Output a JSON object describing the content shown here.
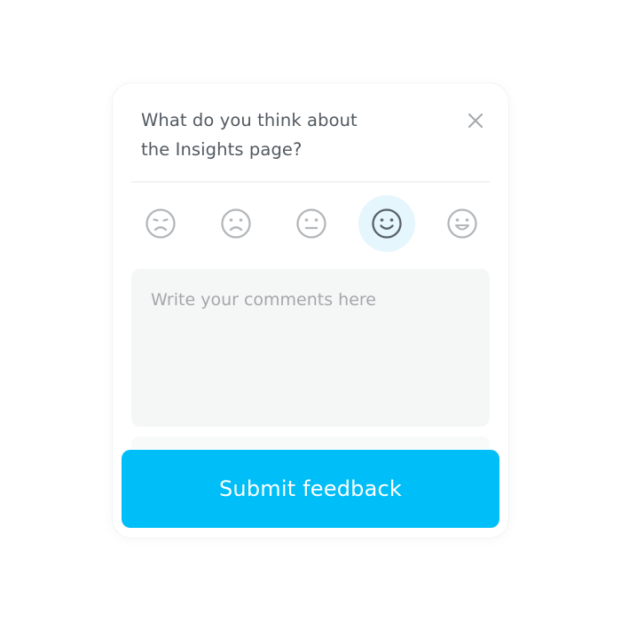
{
  "dialog": {
    "title_line1": "What do you think about",
    "title_line2": "the Insights page?",
    "close_icon": "close-icon"
  },
  "rating": {
    "options": [
      {
        "icon": "crying-face-icon",
        "label": "Very unhappy"
      },
      {
        "icon": "sad-face-icon",
        "label": "Unhappy"
      },
      {
        "icon": "neutral-face-icon",
        "label": "Neutral"
      },
      {
        "icon": "happy-face-icon",
        "label": "Happy"
      },
      {
        "icon": "very-happy-face-icon",
        "label": "Very happy"
      }
    ],
    "selected_index": 3,
    "selected_background": "#e5f6fd"
  },
  "comments": {
    "placeholder": "Write your comments here",
    "value": ""
  },
  "submit": {
    "label": "Submit feedback",
    "color": "#00bef7"
  }
}
